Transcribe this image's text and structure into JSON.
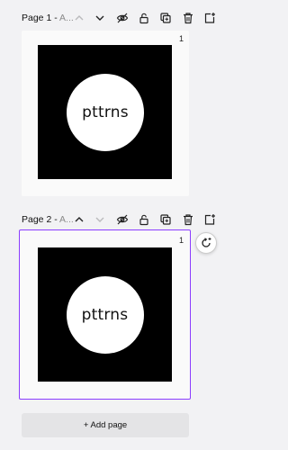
{
  "pages": [
    {
      "title": "Page 1 - ",
      "title_suffix": "A...",
      "page_number": "1",
      "logo_text": "pttrns",
      "selected": false
    },
    {
      "title": "Page 2 - ",
      "title_suffix": "A...",
      "page_number": "1",
      "logo_text": "pttrns",
      "selected": true
    }
  ],
  "add_page_label": "+ Add page",
  "icons": {
    "collapse": "chevron-up-icon",
    "expand": "chevron-down-icon",
    "hide": "eye-slash-icon",
    "lock": "lock-icon",
    "duplicate": "duplicate-icon",
    "delete": "trash-icon",
    "add": "add-page-icon",
    "refresh": "refresh-sparkle-icon"
  },
  "colors": {
    "accent": "#8b3dff",
    "background": "#f2f2f4",
    "design_bg": "#000000"
  }
}
